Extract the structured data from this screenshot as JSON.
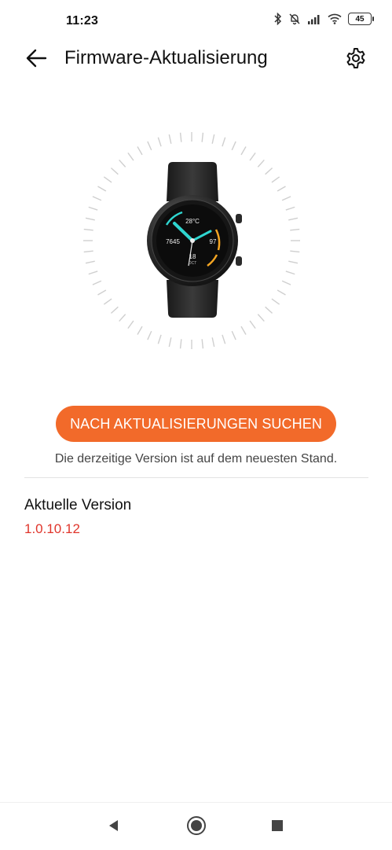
{
  "status_bar": {
    "time": "11:23",
    "icons": [
      "bluetooth-icon",
      "muted-bell-icon",
      "signal-icon",
      "wifi-icon"
    ],
    "battery": "45"
  },
  "app_bar": {
    "title": "Firmware-Aktualisierung",
    "back_icon": "arrow-left-icon",
    "settings_icon": "gear-icon"
  },
  "watch": {
    "complications": {
      "top": "28°C",
      "left": "7645",
      "right": "97",
      "date_num": "18",
      "date_label": "OCT"
    }
  },
  "update": {
    "button_label": "NACH AKTUALISIERUNGEN SUCHEN",
    "status_message": "Die derzeitige Version ist auf dem neuesten Stand."
  },
  "version": {
    "label": "Aktuelle Version",
    "value": "1.0.10.12"
  },
  "navigation": {
    "icons": [
      "back-triangle-icon",
      "home-circle-icon",
      "recents-square-icon"
    ]
  },
  "colors": {
    "accent": "#f26a2a",
    "version_text": "#e0352b",
    "watch_accent": "#2fd6d0",
    "watch_orange": "#f5a623"
  }
}
